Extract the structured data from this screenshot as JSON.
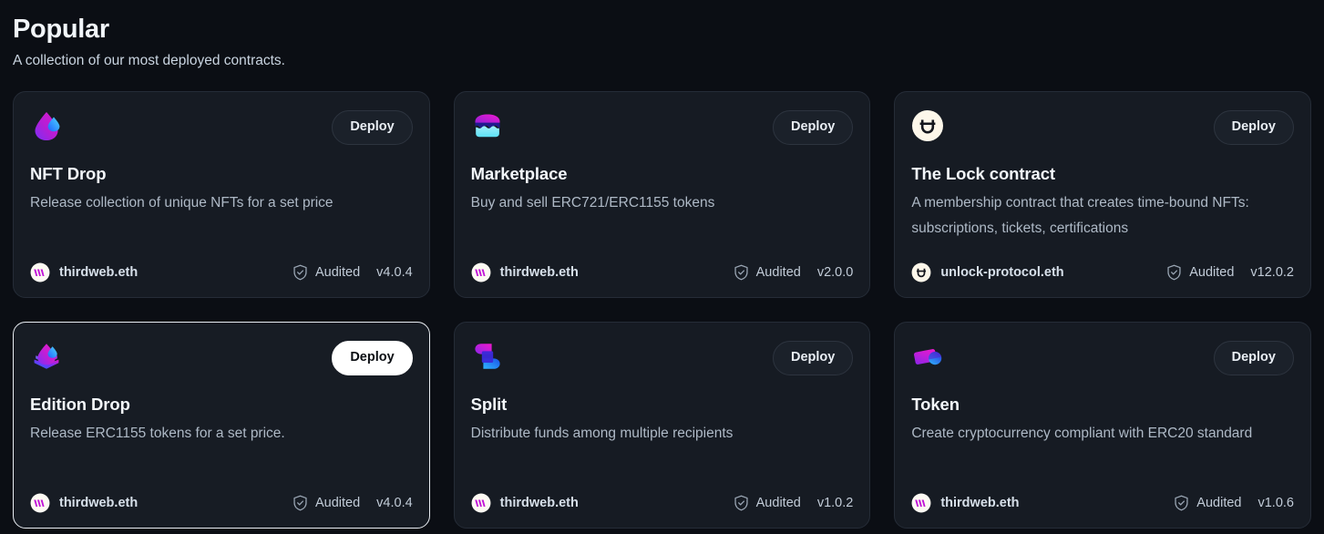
{
  "header": {
    "title": "Popular",
    "subtitle": "A collection of our most deployed contracts."
  },
  "labels": {
    "deploy": "Deploy",
    "audited": "Audited"
  },
  "cards": [
    {
      "icon": "nft-drop-icon",
      "deploy_label": "Deploy",
      "title": "NFT Drop",
      "description": "Release collection of unique NFTs for a set price",
      "publisher": "thirdweb.eth",
      "publisher_avatar": "thirdweb-avatar-icon",
      "audited_label": "Audited",
      "version": "v4.0.4",
      "active": false
    },
    {
      "icon": "marketplace-icon",
      "deploy_label": "Deploy",
      "title": "Marketplace",
      "description": "Buy and sell ERC721/ERC1155 tokens",
      "publisher": "thirdweb.eth",
      "publisher_avatar": "thirdweb-avatar-icon",
      "audited_label": "Audited",
      "version": "v2.0.0",
      "active": false
    },
    {
      "icon": "unlock-protocol-icon",
      "deploy_label": "Deploy",
      "title": "The Lock contract",
      "description": "A membership contract that creates time-bound NFTs: subscriptions, tickets, certifications",
      "publisher": "unlock-protocol.eth",
      "publisher_avatar": "unlock-avatar-icon",
      "audited_label": "Audited",
      "version": "v12.0.2",
      "active": false
    },
    {
      "icon": "edition-drop-icon",
      "deploy_label": "Deploy",
      "title": "Edition Drop",
      "description": "Release ERC1155 tokens for a set price.",
      "publisher": "thirdweb.eth",
      "publisher_avatar": "thirdweb-avatar-icon",
      "audited_label": "Audited",
      "version": "v4.0.4",
      "active": true
    },
    {
      "icon": "split-icon",
      "deploy_label": "Deploy",
      "title": "Split",
      "description": "Distribute funds among multiple recipients",
      "publisher": "thirdweb.eth",
      "publisher_avatar": "thirdweb-avatar-icon",
      "audited_label": "Audited",
      "version": "v1.0.2",
      "active": false
    },
    {
      "icon": "token-icon",
      "deploy_label": "Deploy",
      "title": "Token",
      "description": "Create cryptocurrency compliant with ERC20 standard",
      "publisher": "thirdweb.eth",
      "publisher_avatar": "thirdweb-avatar-icon",
      "audited_label": "Audited",
      "version": "v1.0.6",
      "active": false
    }
  ],
  "colors": {
    "page_bg": "#0b0e14",
    "card_bg": "#161b23",
    "card_border": "#252c37",
    "active_border": "#e9edf2",
    "accent_magenta": "#c724d6",
    "accent_blue": "#2a6ef5",
    "accent_cyan": "#38bdf8",
    "title_text": "#f3f7fb",
    "muted_text": "#aeb9c6"
  }
}
